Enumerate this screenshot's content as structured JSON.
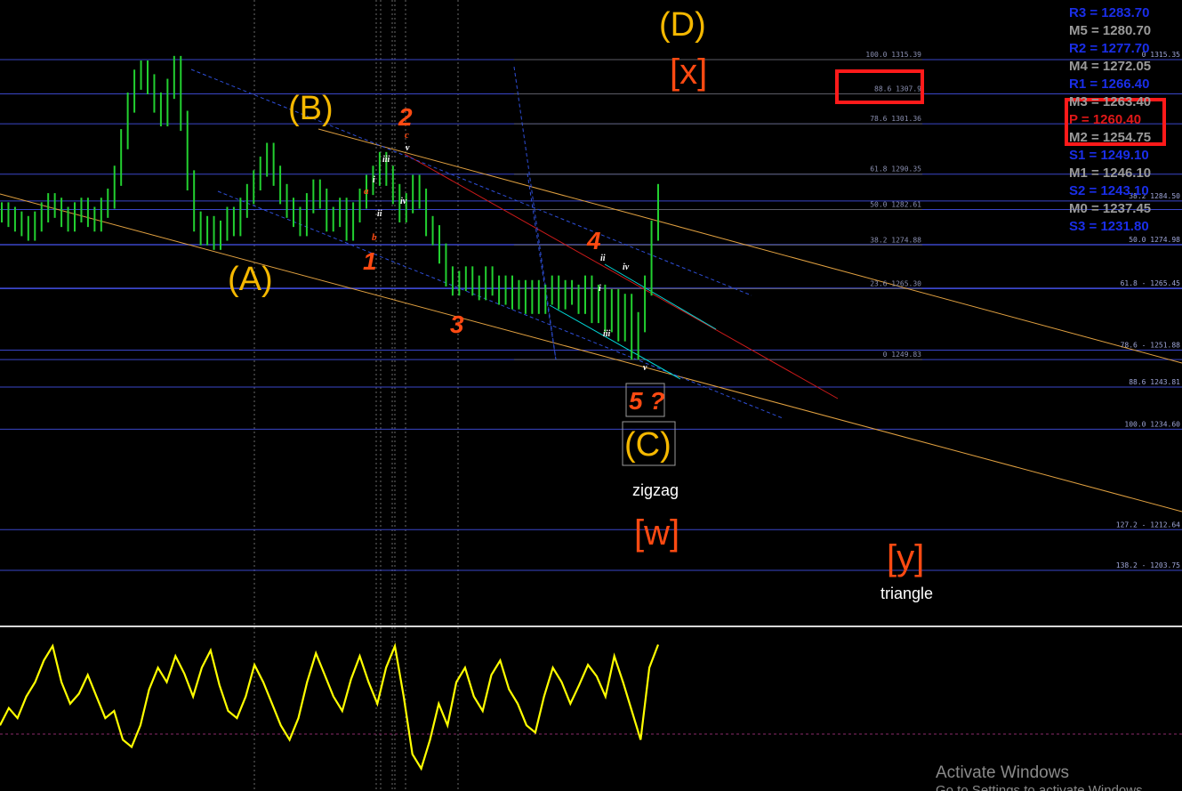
{
  "chart_data": {
    "type": "line",
    "main_panel": {
      "price_series": [
        1282,
        1281,
        1280,
        1279,
        1278,
        1280,
        1282,
        1284,
        1283,
        1281,
        1280,
        1282,
        1283,
        1281,
        1280,
        1283,
        1285,
        1290,
        1298,
        1306,
        1311,
        1313,
        1310,
        1306,
        1303,
        1309,
        1314,
        1302,
        1289,
        1280,
        1277,
        1279,
        1276,
        1278,
        1281,
        1279,
        1283,
        1286,
        1289,
        1292,
        1295,
        1290,
        1286,
        1283,
        1281,
        1279,
        1284,
        1287,
        1285,
        1280,
        1281,
        1283,
        1278,
        1282,
        1285,
        1288,
        1290,
        1293,
        1290,
        1286,
        1282,
        1284,
        1288,
        1285,
        1279,
        1277,
        1273,
        1268,
        1266,
        1267,
        1268,
        1266,
        1265,
        1268,
        1266,
        1264,
        1266,
        1263,
        1265,
        1262,
        1265,
        1262,
        1264,
        1266,
        1263,
        1265,
        1264,
        1262,
        1266,
        1260,
        1264,
        1258,
        1263,
        1256,
        1262,
        1252,
        1258,
        1266,
        1278,
        1286
      ],
      "horizontal_levels": [
        1315.39,
        1307.9,
        1301.36,
        1290.35,
        1284.5,
        1282.61,
        1274.88,
        1274.98,
        1265.3,
        1265.45,
        1251.88,
        1249.83,
        1243.81,
        1234.6,
        1212.64,
        1203.75
      ],
      "fib_left": [
        {
          "label": "100.0 1315.39",
          "price": 1315.39
        },
        {
          "label": "88.6 1307.9",
          "price": 1307.9
        },
        {
          "label": "78.6 1301.36",
          "price": 1301.36
        },
        {
          "label": "61.8 1290.35",
          "price": 1290.35
        },
        {
          "label": "50.0 1282.61",
          "price": 1282.61
        },
        {
          "label": "38.2 1274.88",
          "price": 1274.88
        },
        {
          "label": "23.6 1265.30",
          "price": 1265.3
        },
        {
          "label": "0 1249.83",
          "price": 1249.83
        }
      ],
      "fib_right": [
        {
          "label": "0 1315.35",
          "price": 1315.35
        },
        {
          "label": "38.2 1284.50",
          "price": 1284.5
        },
        {
          "label": "50.0 1274.98",
          "price": 1274.98
        },
        {
          "label": "61.8 - 1265.45",
          "price": 1265.45
        },
        {
          "label": "78.6 - 1251.88",
          "price": 1251.88
        },
        {
          "label": "88.6 1243.81",
          "price": 1243.81
        },
        {
          "label": "100.0 1234.60",
          "price": 1234.6
        },
        {
          "label": "127.2 - 1212.64",
          "price": 1212.64
        },
        {
          "label": "138.2 - 1203.75",
          "price": 1203.75
        }
      ],
      "pivots": [
        {
          "label": "R3 = 1283.70",
          "color": "#1a2ee8"
        },
        {
          "label": "M5 = 1280.70",
          "color": "#9a9a9a"
        },
        {
          "label": "R2 = 1277.70",
          "color": "#1a2ee8"
        },
        {
          "label": "M4 = 1272.05",
          "color": "#9a9a9a"
        },
        {
          "label": "R1 = 1266.40",
          "color": "#1a2ee8"
        },
        {
          "label": "M3 = 1263.40",
          "color": "#9a9a9a"
        },
        {
          "label": "P  = 1260.40",
          "color": "#e01818"
        },
        {
          "label": "M2 = 1254.75",
          "color": "#9a9a9a"
        },
        {
          "label": "S1 = 1249.10",
          "color": "#1a2ee8"
        },
        {
          "label": "M1 = 1246.10",
          "color": "#9a9a9a"
        },
        {
          "label": "S2 = 1243.10",
          "color": "#1a2ee8"
        },
        {
          "label": "M0 = 1237.45",
          "color": "#9a9a9a"
        },
        {
          "label": "S3 = 1231.80",
          "color": "#1a2ee8"
        }
      ],
      "wave_labels_major": [
        "(A)",
        "(B)",
        "(C)",
        "(D)"
      ],
      "wave_labels_bracket": [
        "[x]",
        "[w]",
        "[y]"
      ],
      "wave_labels_impulse": [
        "1",
        "2",
        "3",
        "4",
        "5 ?"
      ],
      "wave_labels_minor_white": [
        "i",
        "ii",
        "iii",
        "iv",
        "v",
        "i",
        "ii",
        "iii",
        "iv",
        "v"
      ],
      "wave_labels_minor_orange": [
        "a",
        "b",
        "c"
      ],
      "text_annotations": [
        "zigzag",
        "triangle"
      ]
    },
    "oscillator_panel": {
      "series_color": "#ffff00",
      "values": [
        40,
        52,
        45,
        60,
        70,
        85,
        95,
        70,
        55,
        62,
        75,
        60,
        45,
        50,
        30,
        25,
        40,
        65,
        80,
        70,
        88,
        76,
        60,
        80,
        92,
        68,
        50,
        45,
        60,
        82,
        70,
        55,
        40,
        30,
        45,
        70,
        90,
        75,
        60,
        50,
        72,
        88,
        70,
        55,
        80,
        95,
        60,
        20,
        10,
        30,
        55,
        40,
        70,
        80,
        60,
        50,
        75,
        85,
        65,
        55,
        40,
        35,
        60,
        80,
        70,
        55,
        68,
        82,
        74,
        60,
        88,
        70,
        50,
        30,
        80,
        96
      ]
    }
  },
  "watermark": {
    "line1": "Activate Windows",
    "line2": "Go to Settings to activate Windows."
  }
}
